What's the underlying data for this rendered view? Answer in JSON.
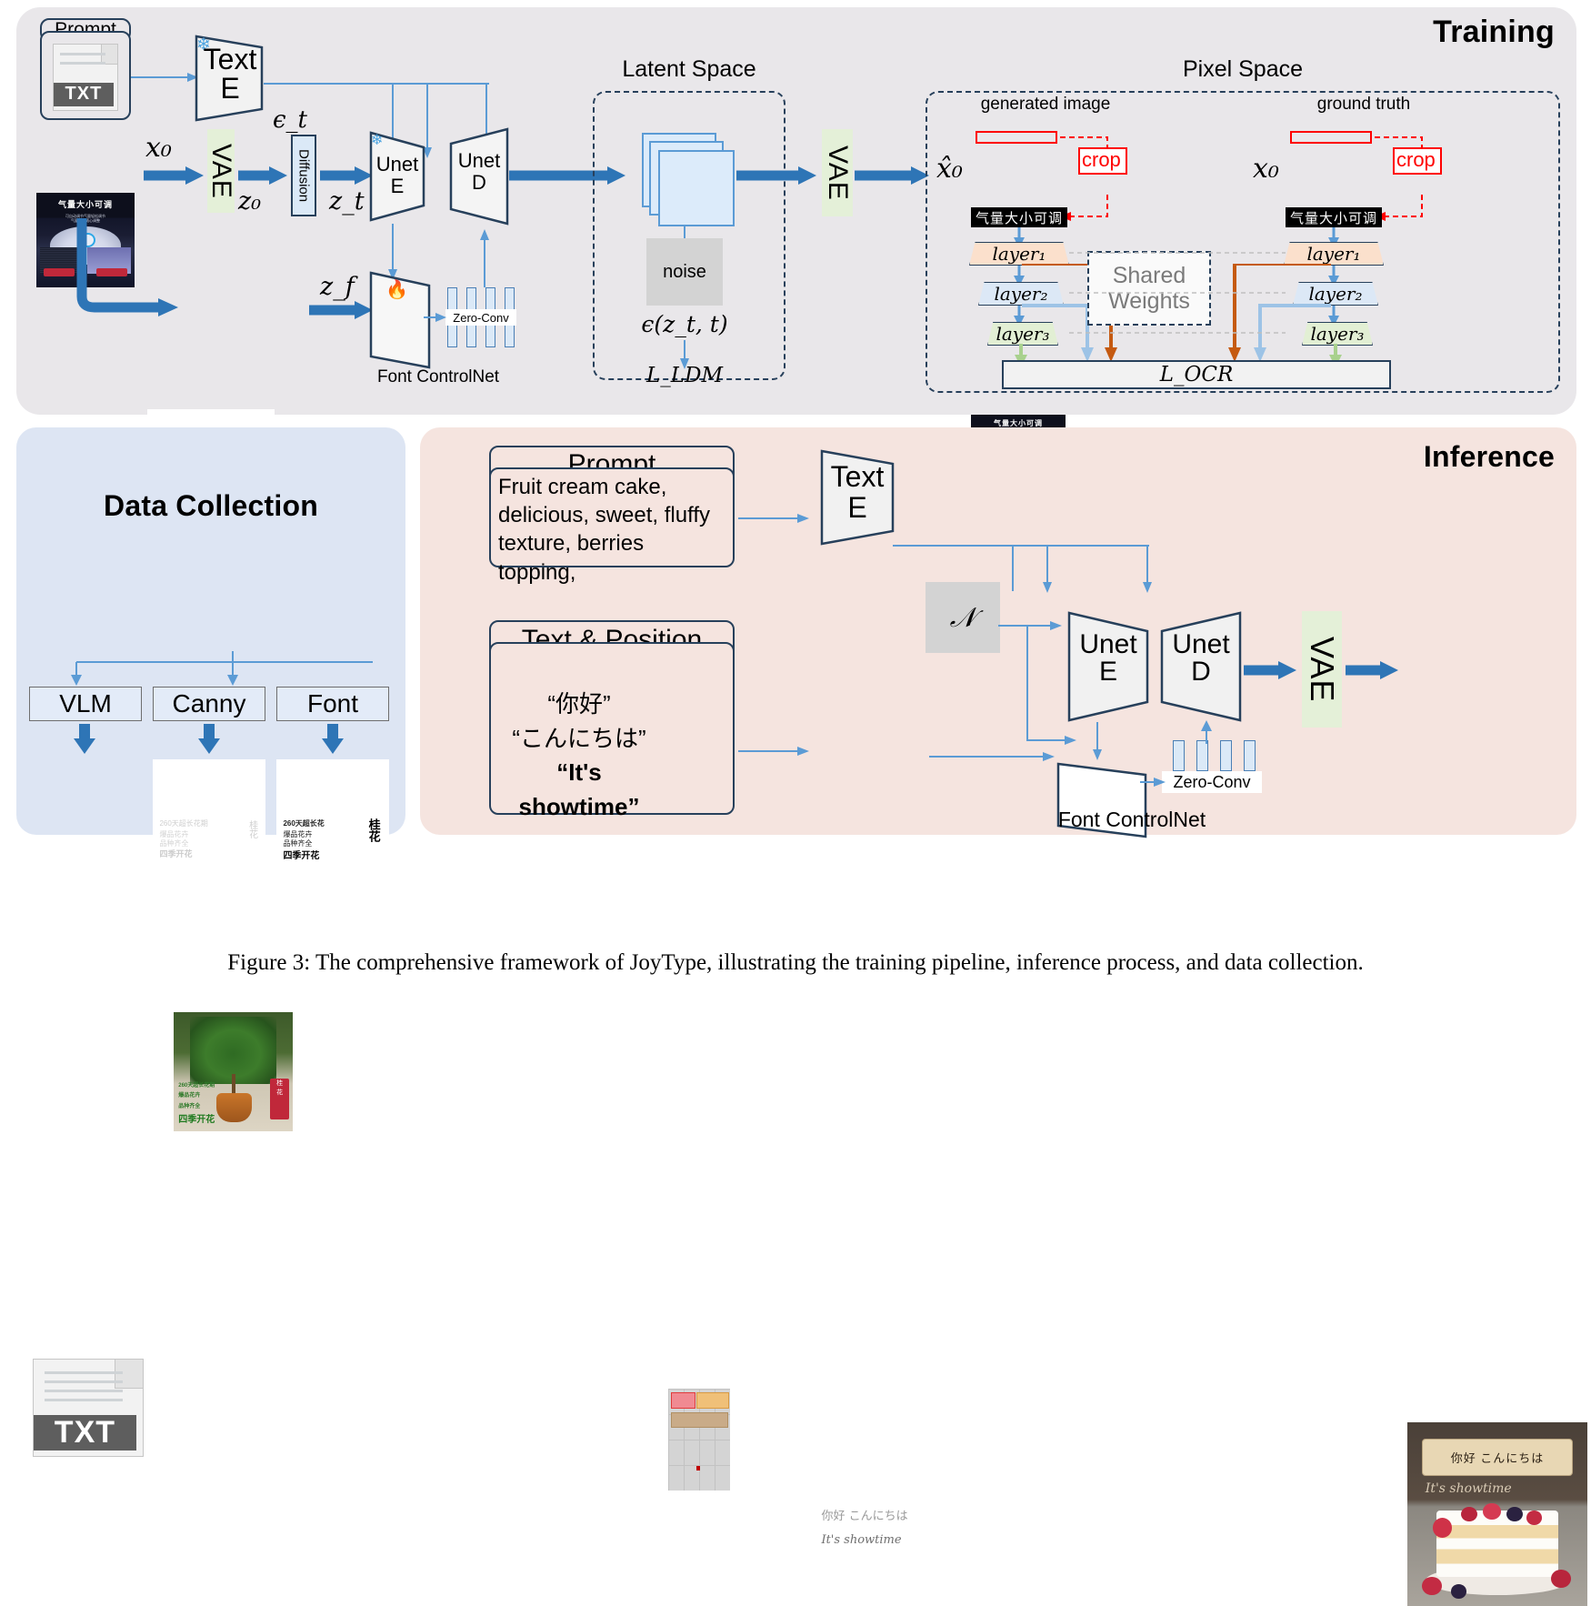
{
  "figure": {
    "caption": "Figure 3: The comprehensive framework of JoyType, illustrating the training pipeline, inference process, and data collection."
  },
  "colors": {
    "training_bg": "#e9e7ea",
    "data_bg": "#dde5f3",
    "inference_bg": "#f5e4df",
    "arrow_blue": "#2e75b6",
    "thin_arrow_blue": "#5b9bd5",
    "outline_navy": "#27405b",
    "crop_red": "#ff0000",
    "vae_green": "#e4f0d8",
    "layer1_peach": "#fbe0cc",
    "layer2_blue": "#dce8f6",
    "layer3_green": "#e2efd4",
    "ocr_orange": "#c55a11",
    "noise_gray": "#d3d3d3"
  },
  "training": {
    "title": "Training",
    "prompt_box": {
      "title": "Prompt",
      "doc_badge": "TXT"
    },
    "text_encoder": {
      "line1": "Text",
      "line2": "E",
      "frozen_icon": "snowflake-icon"
    },
    "vae_label": "VAE",
    "diffusion_label": "Diffusion",
    "unet_encoder": {
      "line1": "Unet",
      "line2": "E",
      "frozen_icon": "snowflake-icon"
    },
    "unet_decoder": {
      "line1": "Unet",
      "line2": "D"
    },
    "font_controlnet": {
      "label": "Font ControlNet",
      "trainable_icon": "flame-icon",
      "zero_conv": "Zero-Conv"
    },
    "symbols": {
      "x0": "x₀",
      "z0": "z₀",
      "zt": "z_t",
      "zf": "z_f",
      "eps_t": "ϵ_t",
      "x0_hat": "x̂₀",
      "x0_gt": "x₀"
    },
    "latent_space": {
      "title": "Latent Space",
      "noise_label": "noise",
      "eps_formula": "ϵ(z_t, t)",
      "loss": "L_LDM"
    },
    "pixel_space": {
      "title": "Pixel Space",
      "generated_caption": "generated image",
      "ground_truth_caption": "ground truth",
      "crop_label": "crop",
      "cropped_text": "气量大小可调",
      "generated_image_text": "气量大小可调",
      "ground_truth_image_text": "气量大小可调",
      "shared_weights": "Shared Weights",
      "layers": [
        "layer₁",
        "layer₂",
        "layer₃"
      ],
      "loss": "L_OCR"
    },
    "font_render_text": "气量大小可调"
  },
  "data_collection": {
    "title": "Data Collection",
    "source_image_texts": [
      "260天超长花期",
      "爆品花卉",
      "品种齐全",
      "四季开花",
      "桂花"
    ],
    "branches": [
      "VLM",
      "Canny",
      "Font"
    ],
    "vlm_output": {
      "badge": "TXT"
    },
    "canny_output_texts": [
      "260天超长花期",
      "爆品花卉",
      "品种齐全",
      "四季开花",
      "桂花"
    ],
    "font_output_texts": [
      "260天超长花",
      "爆品花卉",
      "品种齐全",
      "四季开花",
      "桂花"
    ]
  },
  "inference": {
    "title": "Inference",
    "prompt_box": {
      "title": "Prompt",
      "body": "Fruit cream cake, delicious, sweet, fluffy texture, berries topping,"
    },
    "text_position_box": {
      "title": "Text & Position",
      "items": [
        "“你好”",
        "“こんにちは”",
        "“It's showtime”"
      ]
    },
    "text_encoder": {
      "line1": "Text",
      "line2": "E"
    },
    "noise_symbol": "𝒩",
    "unet_encoder": {
      "line1": "Unet",
      "line2": "E"
    },
    "unet_decoder": {
      "line1": "Unet",
      "line2": "D"
    },
    "font_controlnet": {
      "label": "Font ControlNet",
      "zero_conv": "Zero-Conv"
    },
    "vae_label": "VAE",
    "glyph_canvas_texts": [
      "你好 こんにちは",
      "It's showtime"
    ],
    "result_image": {
      "sign_text": "你好  こんにちは",
      "hand_text": "It's showtime"
    }
  }
}
